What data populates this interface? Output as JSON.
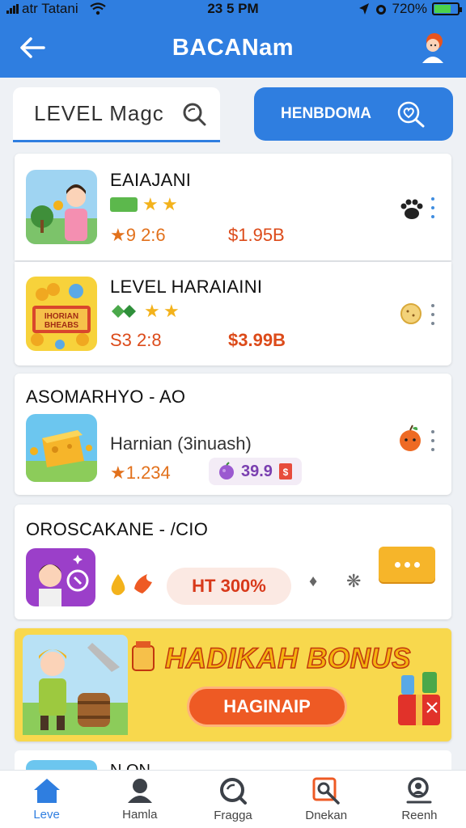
{
  "status_bar": {
    "carrier": "atr Tatani",
    "time": "23 5 PM",
    "battery": "720%",
    "battery_level": 0.72
  },
  "app_bar": {
    "title": "BACANam"
  },
  "search": {
    "value": "LEVEL  Magc",
    "button_label": "HENBDOMA"
  },
  "items": [
    {
      "title": "EAIAJANI",
      "badge": "",
      "stat": "★9 2:6",
      "price": "$1.95B"
    },
    {
      "title": "LEVEL HARAIAINI",
      "badge": "",
      "stat": "S3 2:8",
      "price": "$3.99B"
    },
    {
      "title": "ASOMARHYO - AO",
      "subtitle": "Harnian (3inuash)",
      "stat": "★1.234",
      "price": "39.9"
    },
    {
      "title": "OROSCAKANE - /CIO",
      "pill": "HT 300%"
    }
  ],
  "banner": {
    "title": "HADIKAH BONUS",
    "button_label": "HAGINAIP"
  },
  "peek": {
    "title": "N ON"
  },
  "nav": [
    {
      "label": "Leve",
      "icon": "home-icon"
    },
    {
      "label": "Hamla",
      "icon": "person-icon"
    },
    {
      "label": "Fragga",
      "icon": "search-icon"
    },
    {
      "label": "Dnekan",
      "icon": "image-search-icon"
    },
    {
      "label": "Reenh",
      "icon": "profile-search-icon"
    }
  ],
  "colors": {
    "primary": "#2f7ee0",
    "accent_orange": "#ee5a24",
    "banner_yellow": "#f8d84d",
    "price_orange": "#e2711c"
  }
}
